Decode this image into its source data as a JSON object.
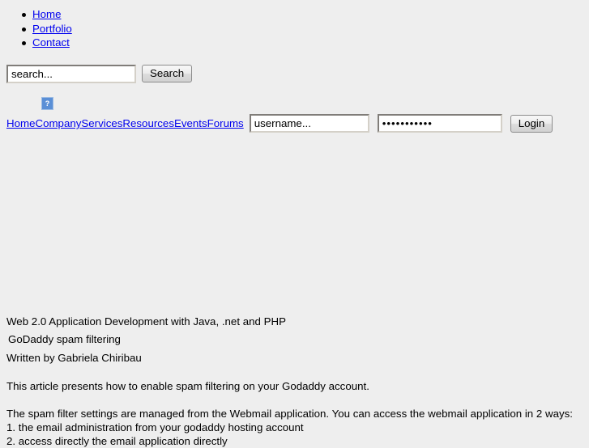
{
  "top_nav": {
    "items": [
      {
        "label": "Home"
      },
      {
        "label": "Portfolio"
      },
      {
        "label": "Contact"
      }
    ]
  },
  "search": {
    "placeholder": "search...",
    "value": "",
    "button_label": "Search"
  },
  "broken_image": {
    "glyph": "?"
  },
  "inline_menu": {
    "items": [
      {
        "label": "Home"
      },
      {
        "label": "Company"
      },
      {
        "label": "Services"
      },
      {
        "label": "Resources"
      },
      {
        "label": "Events"
      },
      {
        "label": "Forums"
      }
    ]
  },
  "login": {
    "username_placeholder": "username...",
    "username_value": "",
    "password_value": "•••••••••••",
    "button_label": "Login"
  },
  "article": {
    "site_title": "Web 2.0 Application Development with Java, .net and PHP",
    "title": "GoDaddy spam filtering",
    "byline": "Written by Gabriela Chiribau",
    "intro": "This article presents how to enable spam filtering on your Godaddy account.",
    "body_line_1": "The spam filter settings are managed from the Webmail application. You can access the webmail application in 2 ways:",
    "body_line_2": "1. the email administration from your godaddy hosting account",
    "body_line_3": "2. access directly the email application directly"
  },
  "colors": {
    "background": "#eeeeee",
    "link": "#0000ee",
    "text": "#000000",
    "broken_image": "#5a8fd6"
  }
}
